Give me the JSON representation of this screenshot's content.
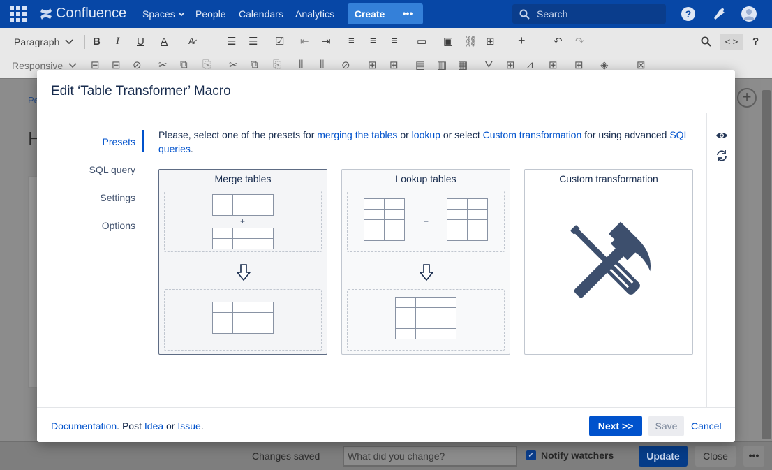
{
  "topnav": {
    "app_name": "Confluence",
    "nav_items": [
      {
        "label": "Spaces",
        "has_dropdown": true
      },
      {
        "label": "People",
        "has_dropdown": false
      },
      {
        "label": "Calendars",
        "has_dropdown": false
      },
      {
        "label": "Analytics",
        "has_dropdown": false
      }
    ],
    "create_label": "Create",
    "more_label": "•••",
    "search_placeholder": "Search",
    "icons": [
      "app-switcher-icon",
      "help-icon",
      "notifications-icon",
      "profile-avatar-icon"
    ]
  },
  "toolbar": {
    "paragraph_select": "Paragraph",
    "responsive_select": "Responsive",
    "code_toggle": "< >",
    "help": "?"
  },
  "page": {
    "breadcrumb_partial": "Pe",
    "title_partial": "H"
  },
  "modal": {
    "title": "Edit ‘Table Transformer’ Macro",
    "tabs": [
      {
        "label": "Presets",
        "active": true
      },
      {
        "label": "SQL query",
        "active": false
      },
      {
        "label": "Settings",
        "active": false
      },
      {
        "label": "Options",
        "active": false
      }
    ],
    "intro": {
      "part1": "Please, select one of the presets for ",
      "link1": "merging the tables",
      "part2": " or ",
      "link2": "lookup",
      "part3": " or select ",
      "link3": "Custom transformation",
      "part4": " for using advanced ",
      "link4": "SQL queries",
      "part5": "."
    },
    "presets": [
      {
        "title": "Merge tables",
        "selected": true
      },
      {
        "title": "Lookup tables",
        "selected": false
      },
      {
        "title": "Custom transformation",
        "selected": false
      }
    ],
    "plus_sign": "+",
    "right_icons": [
      "preview-eye-icon",
      "refresh-icon"
    ],
    "footer": {
      "documentation": "Documentation",
      "post_text": ". Post ",
      "idea": "Idea",
      "or_text": " or ",
      "issue": "Issue",
      "end_text": ".",
      "next_label": "Next >>",
      "save_label": "Save",
      "cancel_label": "Cancel"
    }
  },
  "bottombar": {
    "status": "Changes saved",
    "change_placeholder": "What did you change?",
    "notify_label": "Notify watchers",
    "notify_checked": true,
    "update_label": "Update",
    "close_label": "Close",
    "more_label": "•••"
  },
  "colors": {
    "nav_bg": "#0747a6",
    "primary": "#0052cc",
    "text": "#172b4d",
    "overlay_gray": "#7a7a7a"
  }
}
